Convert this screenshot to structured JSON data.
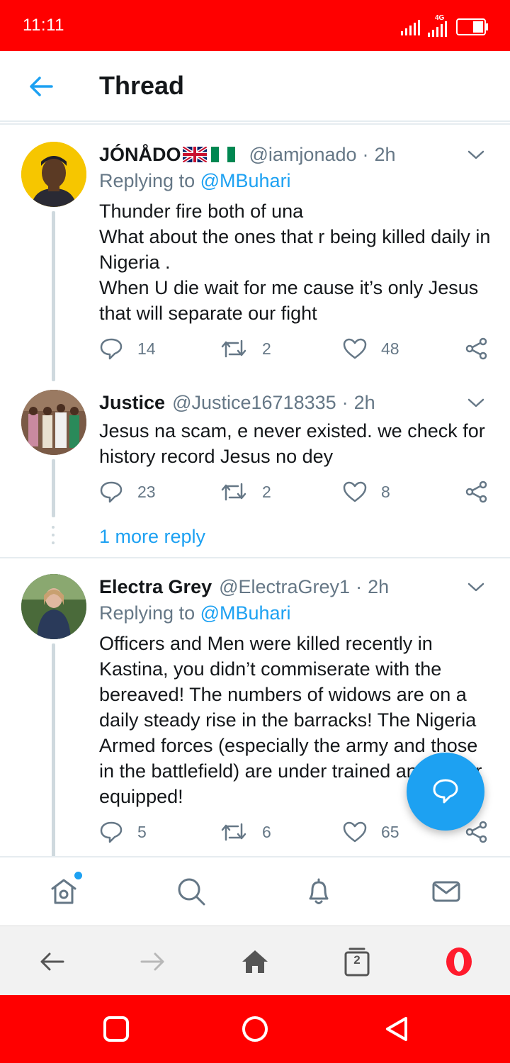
{
  "status_bar": {
    "time": "11:11",
    "network": "4G"
  },
  "header": {
    "title": "Thread"
  },
  "tweets": [
    {
      "name": "JÓNÅDO",
      "handle": "@iamjonado",
      "separator": "·",
      "time": "2h",
      "replying_prefix": "Replying to",
      "replying_to": "@MBuhari",
      "lines": [
        "Thunder fire both of una",
        "What about the ones that r being killed daily in Nigeria .",
        "When U die wait for me cause it’s only Jesus that will separate our fight"
      ],
      "replies": "14",
      "retweets": "2",
      "likes": "48"
    },
    {
      "name": "Justice",
      "handle": "@Justice16718335",
      "separator": "·",
      "time": "2h",
      "lines": [
        "Jesus na scam, e never existed. we check for history record Jesus no dey"
      ],
      "replies": "23",
      "retweets": "2",
      "likes": "8"
    },
    {
      "name": "Electra Grey",
      "handle": "@ElectraGrey1",
      "separator": "·",
      "time": "2h",
      "replying_prefix": "Replying to",
      "replying_to": "@MBuhari",
      "lines": [
        "Officers and Men were killed recently in Kastina, you didn’t commiserate with the bereaved! The numbers of widows are on a daily steady rise in the barracks! The Nigeria Armed forces (especially the army and those in the battlefield) are under trained and under equipped!"
      ],
      "replies": "5",
      "retweets": "6",
      "likes": "65"
    }
  ],
  "more_replies": "1 more reply",
  "browser": {
    "tab_count": "2"
  },
  "colors": {
    "accent": "#1da1f2",
    "status_bar": "#ff0000",
    "muted": "#657786",
    "divider": "#e6ecf0"
  },
  "icons": {
    "twitter_nav": [
      "home-icon",
      "search-icon",
      "bell-icon",
      "mail-icon"
    ],
    "browser_nav": [
      "back-arrow-icon",
      "forward-arrow-icon",
      "home-icon",
      "tabs-icon",
      "opera-icon"
    ],
    "android_nav": [
      "recent-apps-icon",
      "home-circle-icon",
      "back-triangle-icon"
    ]
  }
}
